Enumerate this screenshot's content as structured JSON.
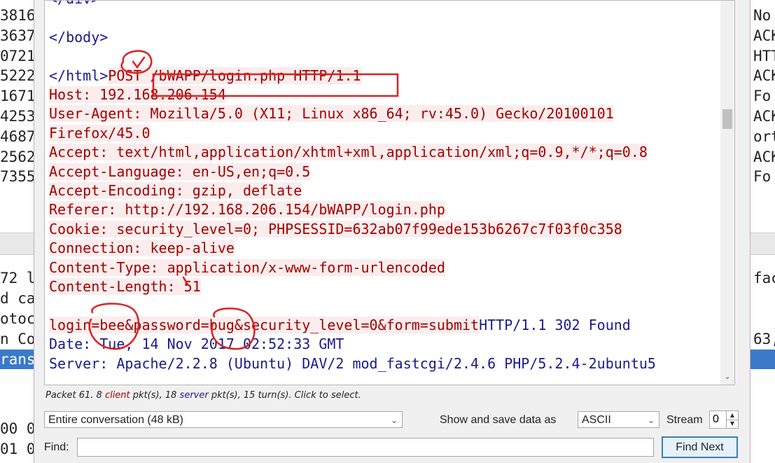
{
  "left_rows": [
    "3816",
    "3637",
    "0721",
    "5222",
    "1671",
    "4253",
    "4687",
    "2562",
    "7355"
  ],
  "left_rows_lower": [
    "72 l",
    "d ca",
    "otoc",
    "n Co",
    "rans"
  ],
  "left_rows_bottom": [
    "00 0",
    "01 0"
  ],
  "right_rows": [
    "No",
    "ACK",
    "HTT",
    "ACK",
    "Fo",
    "ACK",
    "ort",
    "ACK",
    "Fo"
  ],
  "right_rows_lower": [
    "fac",
    "",
    "",
    "63,",
    ""
  ],
  "stream_lines": [
    {
      "text": "</div>",
      "side": "server"
    },
    {
      "text": "",
      "side": "server"
    },
    {
      "text": "</body>",
      "side": "server"
    },
    {
      "text": "",
      "side": "server"
    },
    {
      "text": "</html>",
      "side": "server",
      "cont": "POST /bWAPP/login.php HTTP/1.1"
    },
    {
      "text": "Host: 192.168.206.154",
      "side": "client"
    },
    {
      "text": "User-Agent: Mozilla/5.0 (X11; Linux x86_64; rv:45.0) Gecko/20100101",
      "side": "client"
    },
    {
      "text": "Firefox/45.0",
      "side": "client"
    },
    {
      "text": "Accept: text/html,application/xhtml+xml,application/xml;q=0.9,*/*;q=0.8",
      "side": "client"
    },
    {
      "text": "Accept-Language: en-US,en;q=0.5",
      "side": "client"
    },
    {
      "text": "Accept-Encoding: gzip, deflate",
      "side": "client"
    },
    {
      "text": "Referer: http://192.168.206.154/bWAPP/login.php",
      "side": "client"
    },
    {
      "text": "Cookie: security_level=0; PHPSESSID=632ab07f99ede153b6267c7f03f0c358",
      "side": "client"
    },
    {
      "text": "Connection: keep-alive",
      "side": "client"
    },
    {
      "text": "Content-Type: application/x-www-form-urlencoded",
      "side": "client"
    },
    {
      "text": "Content-Length: 51",
      "side": "client"
    },
    {
      "text": "",
      "side": "client"
    },
    {
      "text": "login=bee&password=bug&security_level=0&form=submit",
      "side": "client",
      "cont": "HTTP/1.1 302 Found"
    },
    {
      "text": "Date: Tue, 14 Nov 2017 02:52:33 GMT",
      "side": "server"
    },
    {
      "text": "Server: Apache/2.2.8 (Ubuntu) DAV/2 mod_fastcgi/2.4.6 PHP/5.2.4-2ubuntu5",
      "side": "server"
    }
  ],
  "stats": {
    "prefix": "Packet 61. ",
    "client_count": "8",
    "client_word": "client",
    "mid": " pkt(s), ",
    "server_count": "18",
    "server_word": "server",
    "suffix": " pkt(s), 15 turn(s). Click to select."
  },
  "conversation_select": "Entire conversation (48 kB)",
  "show_save_label": "Show and save data as",
  "format_select": "ASCII",
  "stream_label": "Stream",
  "stream_value": "0",
  "find_label": "Find:",
  "find_value": "",
  "find_next_label": "Find Next",
  "colors": {
    "client_text": "#a30000",
    "client_bg": "#fbeded",
    "server_text": "#1a1a8c",
    "selection": "#3b79c9",
    "annotation": "#e02020"
  }
}
